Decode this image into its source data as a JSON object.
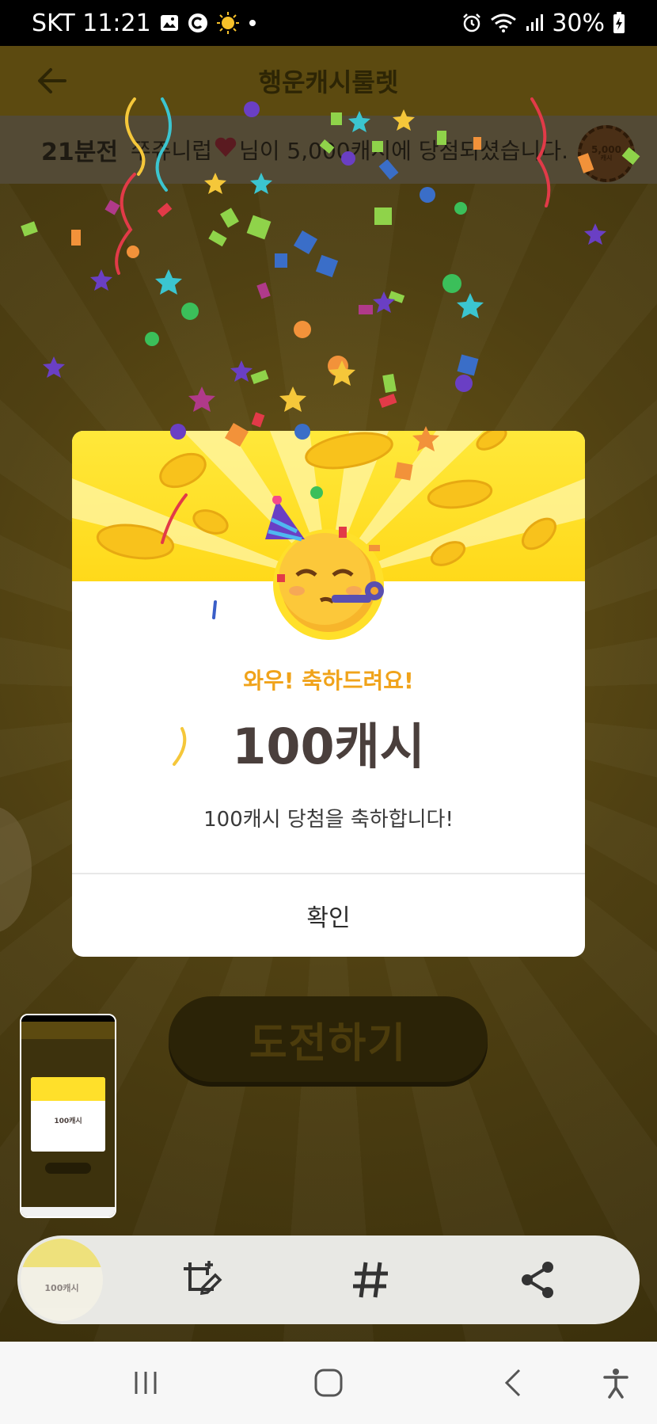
{
  "status_bar": {
    "carrier_time": "SKT 11:21",
    "battery": "30%",
    "icons": [
      "gallery-icon",
      "c-app-icon",
      "sun-app-icon",
      "dot-icon",
      "alarm-icon",
      "wifi-icon",
      "signal-icon",
      "battery-charging-icon"
    ]
  },
  "app_bar": {
    "title": "행운캐시룰렛",
    "back_icon": "arrow-left-icon"
  },
  "ticker": {
    "time": "21분전",
    "user_text": "쭈쥬니럽",
    "heart_icon": "heart-icon",
    "message": "님이 5,000캐시에 당첨되셨습니다.",
    "badge_value": "5,000",
    "badge_unit": "캐시"
  },
  "modal": {
    "subtitle": "와우! 축하드려요!",
    "amount": "100캐시",
    "message": "100캐시 당첨을 축하합니다!",
    "confirm": "확인",
    "hero_icon": "party-face-icon"
  },
  "challenge_button": {
    "label": "도전하기"
  },
  "thumbnail": {
    "amount": "100캐시"
  },
  "toolbar": {
    "thumb_amount": "100캐시",
    "buttons": [
      "crop-edit-icon",
      "hashtag-icon",
      "share-icon"
    ]
  },
  "nav_bar": {
    "buttons": [
      "recents-icon",
      "home-icon",
      "back-icon",
      "accessibility-icon"
    ]
  },
  "colors": {
    "accent_yellow": "#ffd91a",
    "subtitle_orange": "#f0a31a",
    "amount_text": "#4a3f3c",
    "dim_background": "#4a3d10"
  }
}
